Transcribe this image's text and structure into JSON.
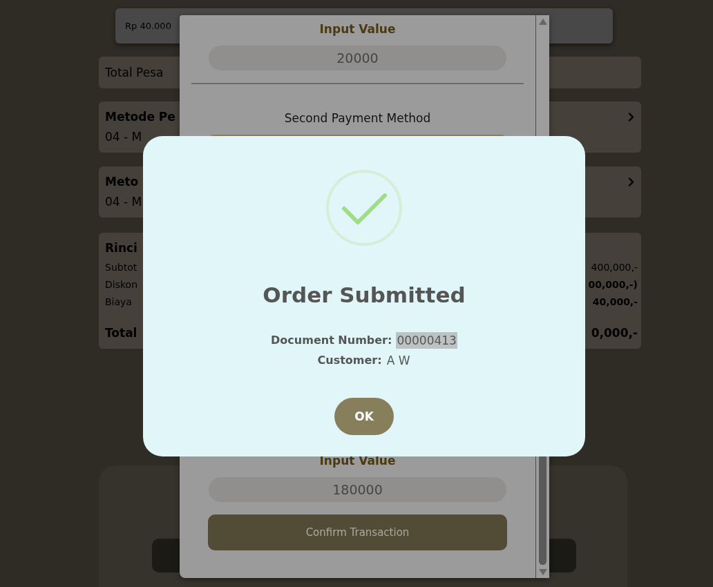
{
  "background_page": {
    "amount_card": {
      "text": "Rp 40.000"
    },
    "total_row": {
      "label": "Total Pesa"
    },
    "payment_method_cards": [
      {
        "title": "Metode Pe",
        "value": "04 - M"
      },
      {
        "title": "Meto",
        "value": "04 - M"
      }
    ],
    "summary": {
      "title": "Rinci",
      "rows": [
        {
          "label": "Subtot",
          "value": "400,000,-",
          "emphasized": false
        },
        {
          "label": "Diskon",
          "value": "00,000,-)",
          "emphasized": true
        },
        {
          "label": "Biaya",
          "value": "40,000,-",
          "emphasized": true
        }
      ],
      "total": {
        "label": "Total",
        "value": "0,000,-"
      }
    }
  },
  "payment_modal": {
    "first_payment": {
      "label": "Input Value",
      "value": "20000"
    },
    "second_payment_method": {
      "label": "Second Payment Method"
    },
    "second_payment": {
      "label": "Input Value",
      "value": "180000"
    },
    "confirm_button": "Confirm Transaction"
  },
  "success_dialog": {
    "title": "Order Submitted",
    "details": [
      {
        "label": "Document Number:",
        "value": "00000413",
        "highlighted": true
      },
      {
        "label": "Customer:",
        "value": "A W",
        "highlighted": false
      }
    ],
    "button": "OK"
  }
}
